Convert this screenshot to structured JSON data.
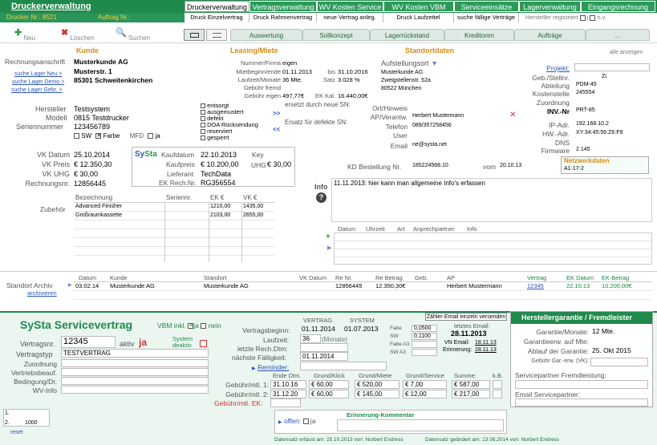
{
  "app": {
    "title": "Druckerverwaltung",
    "drucker_nr_label": "Drucker Nr.:",
    "drucker_nr": "8521",
    "auftrag_nr_label": "Auftrag Nr.:"
  },
  "tabs": [
    "Druckerverwaltung",
    "Vertragsverwaltung",
    "WV Kosten Service",
    "WV Kosten VBM",
    "Serviceeinsätze",
    "Lagerverwaltung",
    "Eingangsrechnung"
  ],
  "subtabs": [
    "Druck Einzelvertrag",
    "Druck Rahmenvertrag",
    "neue Vertrag anleg.",
    "Druck Laufzettel",
    "suche fällige Verträge",
    "Hersteller registriert",
    "j",
    "n.v."
  ],
  "toolbar": {
    "new": "Neu",
    "delete": "Löschen",
    "search": "Suchen"
  },
  "navtabs": [
    "Auswertung",
    "Sollkonzept",
    "Lagerrückstand",
    "Kreditoren",
    "Aufträge",
    "..."
  ],
  "alle_anzeigen": "alle anzeigen",
  "kunde": {
    "title": "Kunde",
    "rechnungsanschrift": "Rechnungsanschrift",
    "name": "Musterkunde AG",
    "street": "Musterstr. 1",
    "city": "85301 Schweitenkirchen",
    "links": [
      "suche Lager Neu >",
      "suche Lager Demo >",
      "suche Lager Gebr. >"
    ]
  },
  "leasing": {
    "title": "Leasing/Miete",
    "rows": [
      {
        "label": "Nummer/Firma",
        "value": "eigen",
        "extra_label": "",
        "extra": ""
      },
      {
        "label": "Mietbeginn/ende",
        "value": "01.11.2013",
        "extra_label": "bis",
        "extra": "31.10.2016"
      },
      {
        "label": "Laufzeit/Monate",
        "value": "36 Mte.",
        "extra_label": "Satz",
        "extra": "3.028 %"
      },
      {
        "label": "Gebühr fremd",
        "value": "",
        "extra_label": "",
        "extra": ""
      },
      {
        "label": "Gebühr eigen",
        "value": "497,77€",
        "extra_label": "EK Kal.",
        "extra": "16.440,00€"
      }
    ]
  },
  "standort": {
    "title": "Standortdaten",
    "aufstellungsort": "Aufstellungsort",
    "name": "Musterkunde AG",
    "street": "Zweigstellenstr. 52a",
    "city": "80522 München",
    "fields": [
      {
        "label": "Projekt:",
        "value": ""
      },
      {
        "label": "Geb./Stellnr.",
        "value": "Zi."
      },
      {
        "label": "Abteilung",
        "value": "PDM-45"
      },
      {
        "label": "Kostenstelle",
        "value": "245554"
      },
      {
        "label": "Zuordnung",
        "value": ""
      },
      {
        "label": "INV.-Nr",
        "value": "PRT-85"
      },
      {
        "label": "IP-Adr.",
        "value": "192.168.10.2"
      },
      {
        "label": "HW.-Adr.",
        "value": "XY:34:45:56:Z6:F9"
      },
      {
        "label": "DNS",
        "value": ""
      },
      {
        "label": "Firmware",
        "value": "2.145"
      }
    ],
    "netzwerk_title": "Netzwerkdaten",
    "netzwerk_value": "A1-17-2"
  },
  "device": {
    "hersteller_label": "Hersteller",
    "hersteller": "Testsystem",
    "modell_label": "Modell",
    "modell": "0815 Testdrucker",
    "serien_label": "Seriennummer",
    "serien": "123456789",
    "sw": "SW",
    "farbe": "Farbe",
    "mfd": "MFD",
    "ja": "ja"
  },
  "status_checks": [
    "entsorgt",
    "ausgemustert",
    "defekt",
    "DOA Rücksendung",
    "reserviert",
    "gesperrt"
  ],
  "ersetzt": {
    "durch": "ersetzt durch neue SN:",
    "fuer": "Ersatz für defekte SN:"
  },
  "ort": {
    "rows": [
      {
        "label": "Ort/Hinweis",
        "value": ""
      },
      {
        "label": "AP/Verantw.",
        "value": "Herbert Mustermann"
      },
      {
        "label": "Telefon",
        "value": "089/357258456"
      },
      {
        "label": "User",
        "value": ""
      },
      {
        "label": "Email",
        "value": "ne@systa.net"
      }
    ],
    "kd_label": "KD Bestellung Nr.",
    "kd_value": "185224568.10",
    "vom_label": "vom",
    "vom_value": "20.10.13"
  },
  "vk": {
    "rows": [
      {
        "label": "VK Datum",
        "value": "25.10.2014"
      },
      {
        "label": "VK Preis",
        "value": "€ 12.350,30"
      },
      {
        "label": "VK UHG",
        "value": "€ 30,00"
      },
      {
        "label": "Rechnungsnr.",
        "value": "12856445"
      }
    ]
  },
  "systa": {
    "logo1": "Sy",
    "logo2": "Sta",
    "kaufdatum_label": "Kaufdatum",
    "kaufdatum": "22.10.2013",
    "key_label": "Key",
    "kaufpreis_label": "Kaufpreis",
    "kaufpreis": "€ 10.200,00",
    "uhg_label": "UHG",
    "uhg": "€ 30,00",
    "lieferant_label": "Lieferant",
    "lieferant": "TechData",
    "ekrech_label": "EK Rech.Nr.",
    "ekrech": "RG356554"
  },
  "info": {
    "label": "Info",
    "text": "11.11.2013: hier kann man allgemeine Info's erfassen"
  },
  "zubehoer": {
    "label": "Zubehör",
    "headers": [
      "Bezeichnung",
      "Seriennr.",
      "EK €",
      "VK €"
    ],
    "rows": [
      [
        "Advanced Finisher",
        "",
        "1210,00",
        "1435,00"
      ],
      [
        "Großraumkassette",
        "",
        "2103,00",
        "2655,00"
      ]
    ]
  },
  "contacts": {
    "headers": [
      "Datum",
      "Uhrzeit",
      "Art",
      "Anprechpartner",
      "Info"
    ]
  },
  "archiv": {
    "label": "Standort Archiv",
    "link": "archivieren",
    "headers": [
      "Datum",
      "Kunde",
      "Standort",
      "VK Datum",
      "Re Nr.",
      "Re Betrag",
      "Geb.",
      "AP",
      "Vertrag",
      "EK Datum",
      "EK Betrag"
    ],
    "row": [
      "03.02.14",
      "Musterkunde AG",
      "Musterkunde AG",
      "",
      "12856445",
      "12.350,30€",
      "",
      "Herbert Mustermann",
      "12345",
      "22.10.13",
      "10.200,00€"
    ]
  },
  "service": {
    "title": "SySta Servicevertrag",
    "vbm_label": "VBM inkl.",
    "vbm_ja": "ja",
    "vbm_nein": "nein",
    "vertragsnr_label": "Vertragsnr.",
    "vertragsnr": "12345",
    "aktiv_label": "aktiv",
    "aktiv_val": "ja",
    "system_deaktiv": "System deaktiv",
    "vertragstyp_label": "Vertragstyp",
    "vertragstyp": "TESTVERTRAG",
    "labels": [
      "Zuordnung",
      "Vertriebsbeauf.",
      "Bedingung/Dr.",
      "WV-Info"
    ],
    "counter": [
      "1.",
      "2.",
      "1000"
    ],
    "reset": "reset"
  },
  "vertrag": {
    "col1": "VERTRAG",
    "col2": "SYSTEM",
    "beginn_label": "Vertragsbeginn:",
    "beginn": "01.11.2014",
    "beginn_sys": "01.07.2013",
    "laufzeit_label": "Laufzeit:",
    "laufzeit": "36",
    "monate": "(Monate)",
    "letzte_label": "letzte Rech.Dtm:",
    "naechste_label": "nächste Fälligkeit:",
    "naechste": "01.11.2014",
    "reminder": "Reminder:",
    "fabe": [
      {
        "label": "Fabe",
        "value": "0,0500"
      },
      {
        "label": "SW",
        "value": "0,1100"
      },
      {
        "label": "Fabe A3",
        "value": ""
      },
      {
        "label": "SW A3",
        "value": ""
      }
    ],
    "zaehler_btn": "Zähler-Email einzeln versenden",
    "letztes_email": "letztes Email:",
    "letztes_email_val": "28.11.2013",
    "vn_email": "VN Email:",
    "vn_email_val": "18.11.13",
    "erinnerung": "Erinnerung:",
    "erinnerung_val": "28.11.13"
  },
  "gebuehr": {
    "headers": [
      "Ende Dtm.",
      "Grund/Klick",
      "Grund/Miete",
      "Grund/Service",
      "Summe:",
      "k.B."
    ],
    "rows": [
      {
        "label": "Gebühr/mtl. 1:",
        "ende": "31.10.16",
        "klick": "€ 60,00",
        "miete": "€ 520,00",
        "service": "€ 7,00",
        "summe": "€ 587,00"
      },
      {
        "label": "Gebühr/mtl. 2:",
        "ende": "31.12.20",
        "klick": "€ 60,00",
        "miete": "€ 145,00",
        "service": "€ 12,00",
        "summe": "€ 217,00"
      }
    ],
    "ek_label": "Gebühr/mtl. EK:"
  },
  "offen": {
    "label": "offen:",
    "ja": "ja",
    "erinnerung_title": "Erinnerung-Kommentar"
  },
  "garantie": {
    "title": "Herstellergarantie / Fremdleister",
    "rows": [
      {
        "label": "Garantie/Monate:",
        "value": "12 Mte."
      },
      {
        "label": "Garantieerw. auf Mte:",
        "value": ""
      },
      {
        "label": "Ablauf der Garantie:",
        "value": "25. Okt 2015"
      },
      {
        "label": "Gebühr Gar.-erw. (VK):",
        "value": ""
      }
    ],
    "partner_label": "Servicepartner Fremdleistung:",
    "email_label": "Email Servicepartner:"
  },
  "footer": {
    "erfasst": "Datensatz erfasst am: 25.10.2013 von: Norbert Endress",
    "geaendert": "Datensatz geändert am: 13.06.2014 von: Norbert Endress"
  }
}
